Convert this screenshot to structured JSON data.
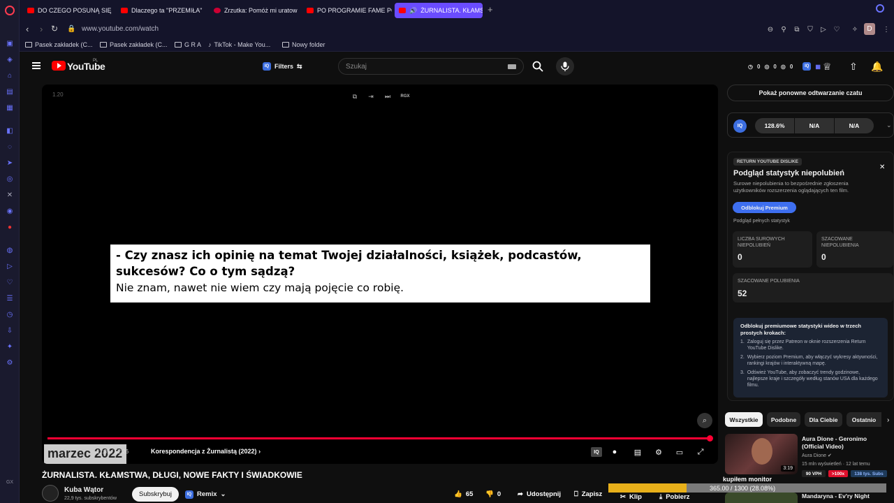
{
  "browser": {
    "tabs": [
      {
        "label": "DO CZEGO POSUNĄ SIĘ K"
      },
      {
        "label": "Dlaczego ta \"PRZEMIŁA\""
      },
      {
        "label": "Zrzutka: Pomóż mi uratow"
      },
      {
        "label": "PO PROGRAMIE FAME PO"
      },
      {
        "label": "ŻURNALISTA. KŁAMST"
      }
    ],
    "url": "www.youtube.com/watch",
    "profile_initial": "D",
    "bookmarks": [
      {
        "label": "Pasek zakładek (C..."
      },
      {
        "label": "Pasek zakładek (C..."
      },
      {
        "label": "G R A"
      },
      {
        "label": "TikTok - Make You..."
      },
      {
        "label": "Nowy folder"
      }
    ]
  },
  "header": {
    "logo_text": "YouTube",
    "logo_country": "PL",
    "filters_label": "Filters",
    "iq_label": "IQ",
    "search_placeholder": "Szukaj",
    "counters": [
      "0",
      "0",
      "0"
    ]
  },
  "player": {
    "speed": "1.20",
    "subtitle_question": "- Czy znasz ich opinię na temat Twojej działalności, książek, podcastów, sukcesów? Co o tym sądzą?",
    "subtitle_answer": "Nie znam, nawet nie wiem czy mają pojęcie co robię.",
    "date_overlay": "marzec 2022",
    "time": "11:39 / 52:26",
    "chapter": "Korespondencja z Żurnalistą (2022)",
    "progress": 0.998,
    "rgx_label": "RGX"
  },
  "video": {
    "title": "ŻURNALISTA. KŁAMSTWA, DŁUGI, NOWE FAKTY I ŚWIADKOWIE",
    "channel": "Kuba Wątor",
    "subscribers": "22,9 tys. subskrybentów",
    "subscribe_label": "Subskrybuj",
    "remix_label": "Remix",
    "likes": "65",
    "dislikes": "0",
    "share_label": "Udostępnij",
    "save_label": "Zapisz",
    "clip_label": "Klip",
    "download_label": "Pobierz"
  },
  "overlay": {
    "label": "kupiłem monitor",
    "text": "365.00 / 1300 (28.08%)",
    "progress": 0.2808,
    "color": "#e8b01a"
  },
  "sidebar_panel": {
    "replay_chat": "Pokaż ponowne odtwarzanie czatu",
    "iq_stats": [
      "128.6%",
      "N/A",
      "N/A"
    ],
    "ryd_tag": "RETURN YOUTUBE DISLIKE",
    "title": "Podgląd statystyk niepolubień",
    "description": "Surowe niepolubienia to bezpośrednie zgłoszenia użytkowników rozszerzenia oglądających ten film.",
    "unlock_button": "Odblokuj Premium",
    "full_stats": "Podgląd pełnych statystyk",
    "stats": [
      {
        "label": "LICZBA SUROWYCH NIEPOLUBIEŃ",
        "value": "0"
      },
      {
        "label": "SZACOWANE NIEPOLUBIENIA",
        "value": "0"
      },
      {
        "label": "SZACOWANE POLUBIENIA",
        "value": "52"
      }
    ],
    "steps_title": "Odblokuj premiumowe statystyki wideo w trzech prostych krokach:",
    "steps": [
      "Zaloguj się przez Patreon w oknie rozszerzenia Return YouTube Dislike.",
      "Wybierz poziom Premium, aby włączyć wykresy aktywności, rankingi krajów i interaktywną mapę.",
      "Odśwież YouTube, aby zobaczyć trendy godzinowe, najlepsze kraje i szczegóły według stanów USA dla każdego filmu."
    ]
  },
  "chips": [
    "Wszystkie",
    "Podobne",
    "Dla Ciebie",
    "Ostatnio"
  ],
  "recommendations": [
    {
      "title": "Aura Dione - Geronimo (Official Video)",
      "channel": "Aura Dione",
      "meta": "15 mln wyświetleń · 12 lat temu",
      "duration": "3:19",
      "vph": "90 VPH",
      "badge": ">100x",
      "subs": "138 tys. Subs"
    },
    {
      "title": "Mandaryna - Ev'ry Night"
    }
  ]
}
